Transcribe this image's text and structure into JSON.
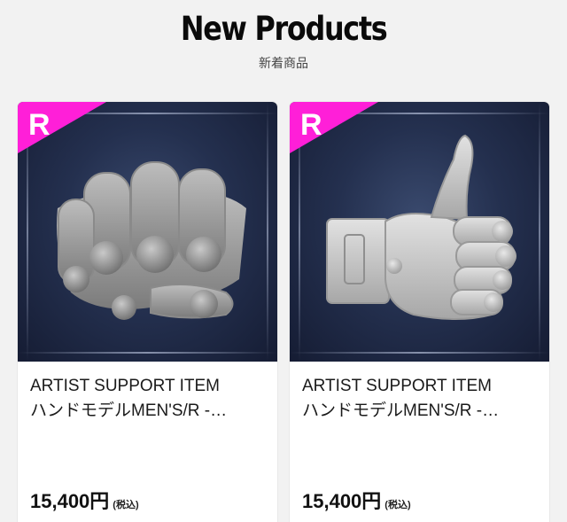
{
  "header": {
    "title": "New Products",
    "subtitle": "新着商品"
  },
  "colors": {
    "accent_rank": "#ff1fd8",
    "photo_background": "#24304f"
  },
  "products": [
    {
      "rank": "R",
      "name_line1": "ARTIST SUPPORT ITEM",
      "name_line2": "ハンドモデルMEN'S/R -…",
      "price": "15,400円",
      "tax_note": "(税込)",
      "image": "hand-model-fist"
    },
    {
      "rank": "R",
      "name_line1": "ARTIST SUPPORT ITEM",
      "name_line2": "ハンドモデルMEN'S/R -…",
      "price": "15,400円",
      "tax_note": "(税込)",
      "image": "hand-model-thumbs-up"
    }
  ]
}
